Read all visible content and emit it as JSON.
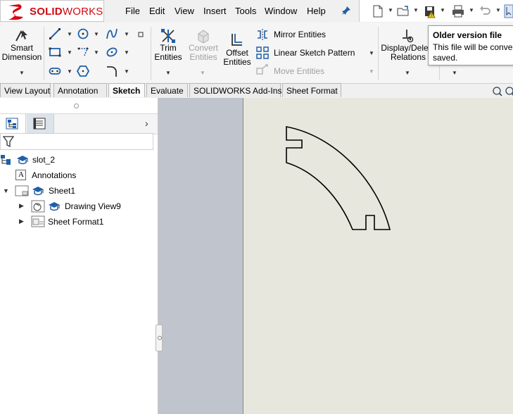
{
  "app": {
    "logo_text_bold": "SOLID",
    "logo_text_rest": "WORKS",
    "brand_color": "#d10a11"
  },
  "menu": [
    "File",
    "Edit",
    "View",
    "Insert",
    "Tools",
    "Window",
    "Help"
  ],
  "ribbon": {
    "smart_dimension": [
      "Smart",
      "Dimension"
    ],
    "trim_entities": [
      "Trim",
      "Entities"
    ],
    "convert_entities": [
      "Convert",
      "Entities"
    ],
    "offset_entities": [
      "Offset",
      "Entities"
    ],
    "mirror_entities": "Mirror Entities",
    "linear_sketch_pattern": "Linear Sketch Pattern",
    "move_entities": "Move Entities",
    "display_delete_relations": [
      "Display/Delete",
      "Relations"
    ]
  },
  "tooltip": {
    "title": "Older version file",
    "body_line1": "This file will be converted when",
    "body_line2": "saved."
  },
  "tabs": [
    "View Layout",
    "Annotation",
    "Sketch",
    "Evaluate",
    "SOLIDWORKS Add-Ins",
    "Sheet Format"
  ],
  "active_tab": "Sketch",
  "tree": {
    "root": "slot_2",
    "annotations": "Annotations",
    "sheet": "Sheet1",
    "drawing_view": "Drawing View9",
    "sheet_format": "Sheet Format1"
  },
  "colors": {
    "graphics_gray": "#c0c4cc",
    "sheet_bg": "#e7e7dd",
    "accent_blue": "#1f5fa8"
  }
}
